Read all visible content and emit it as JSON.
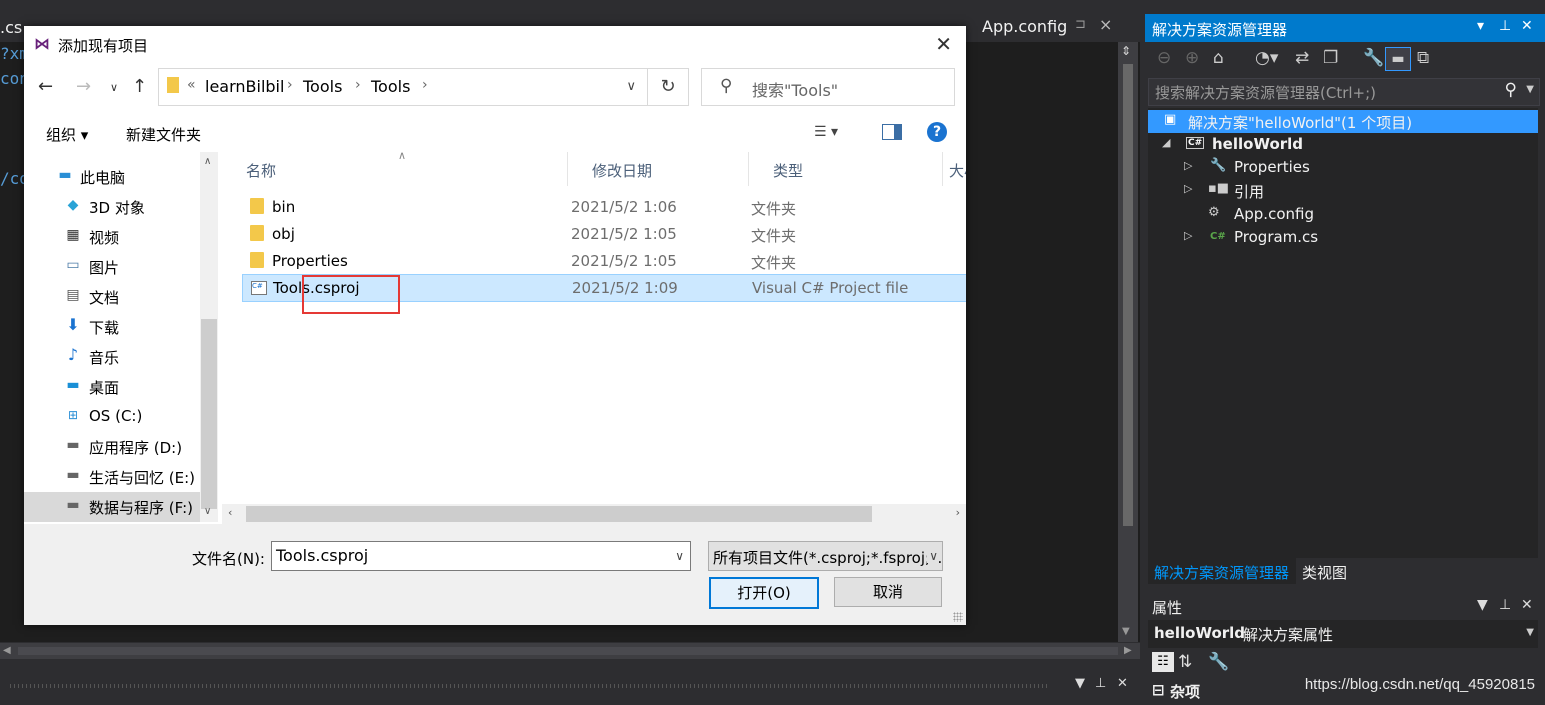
{
  "editor": {
    "tab_partial": ".cs",
    "code_frags": [
      "?xm",
      "con",
      "/co"
    ],
    "tab_appconfig": {
      "label": "App.config",
      "pin": "⊐",
      "close": "×"
    }
  },
  "solution_explorer": {
    "title": "解决方案资源管理器",
    "title_controls": [
      "▾",
      "⊥",
      "✕"
    ],
    "toolbar_icons": [
      "back-icon",
      "forward-icon",
      "home-icon",
      "history-icon",
      "sync-icon",
      "collapse-icon",
      "properties-icon",
      "preview-icon",
      "view-switch-icon"
    ],
    "search_placeholder": "搜索解决方案资源管理器(Ctrl+;)",
    "tree": [
      {
        "label": "解决方案\"helloWorld\"(1 个项目)",
        "icon": "solution-icon",
        "selected": true
      },
      {
        "label": "helloWorld",
        "icon": "csharp-project-icon",
        "expander": "◢",
        "bold": true
      },
      {
        "label": "Properties",
        "icon": "wrench-icon",
        "expander": "▷"
      },
      {
        "label": "引用",
        "icon": "references-icon",
        "expander": "▷"
      },
      {
        "label": "App.config",
        "icon": "config-icon"
      },
      {
        "label": "Program.cs",
        "icon": "csharp-file-icon",
        "expander": "▷"
      }
    ],
    "tabs": [
      "解决方案资源管理器",
      "类视图"
    ]
  },
  "properties": {
    "title": "属性",
    "object_name": "helloWorld",
    "object_type": "解决方案属性",
    "section": "杂项"
  },
  "watermark": "https://blog.csdn.net/qq_45920815",
  "dialog": {
    "title": "添加现有项目",
    "close": "✕",
    "breadcrumb": [
      "«",
      "learnBilbil",
      "Tools",
      "Tools"
    ],
    "search_placeholder": "搜索\"Tools\"",
    "toolbar": {
      "organize": "组织 ▾",
      "new_folder": "新建文件夹",
      "help": "?"
    },
    "nav_items": [
      {
        "label": "此电脑",
        "icon": "computer-icon"
      },
      {
        "label": "3D 对象",
        "icon": "3d-objects-icon"
      },
      {
        "label": "视频",
        "icon": "video-icon"
      },
      {
        "label": "图片",
        "icon": "pictures-icon"
      },
      {
        "label": "文档",
        "icon": "documents-icon"
      },
      {
        "label": "下载",
        "icon": "download-icon"
      },
      {
        "label": "音乐",
        "icon": "music-icon"
      },
      {
        "label": "桌面",
        "icon": "desktop-icon"
      },
      {
        "label": "OS (C:)",
        "icon": "os-drive-icon"
      },
      {
        "label": "应用程序 (D:)",
        "icon": "drive-icon"
      },
      {
        "label": "生活与回忆 (E:)",
        "icon": "drive-icon"
      },
      {
        "label": "数据与程序 (F:)",
        "icon": "drive-icon",
        "selected": true
      }
    ],
    "columns": [
      "名称",
      "修改日期",
      "类型",
      "大小"
    ],
    "files": [
      {
        "name": "bin",
        "date": "2021/5/2 1:06",
        "type": "文件夹",
        "icon": "folder-icon"
      },
      {
        "name": "obj",
        "date": "2021/5/2 1:05",
        "type": "文件夹",
        "icon": "folder-icon"
      },
      {
        "name": "Properties",
        "date": "2021/5/2 1:05",
        "type": "文件夹",
        "icon": "folder-icon"
      },
      {
        "name": "Tools.csproj",
        "date": "2021/5/2 1:09",
        "type": "Visual C# Project file",
        "icon": "csproj-file-icon",
        "selected": true
      }
    ],
    "filename_label": "文件名(N):",
    "filename_value": "Tools.csproj",
    "filter_value": "所有项目文件(*.csproj;*.fsproj;*.vbproj)",
    "open_label": "打开(O)",
    "cancel_label": "取消"
  }
}
